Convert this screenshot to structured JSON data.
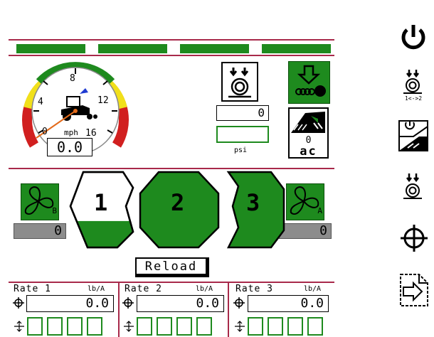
{
  "speedometer": {
    "labels": [
      "0",
      "4",
      "8",
      "12",
      "16"
    ],
    "unit": "mph",
    "speed": "0.0",
    "needle_value": 0
  },
  "seed_meter": {
    "value": "0",
    "unit": "psi"
  },
  "ac": {
    "count": "0",
    "label": "ac"
  },
  "fans": [
    {
      "letter": "B",
      "value": "0"
    },
    {
      "letter": "A",
      "value": "0"
    }
  ],
  "bins": [
    {
      "label": "1",
      "fill_fraction": 0.35
    },
    {
      "label": "2",
      "fill_fraction": 1.0
    },
    {
      "label": "3",
      "fill_fraction": 1.0
    }
  ],
  "reload_button": "Reload",
  "rates": [
    {
      "label": "Rate 1",
      "unit": "lb/A",
      "value": "0.0"
    },
    {
      "label": "Rate 2",
      "unit": "lb/A",
      "value": "0.0"
    },
    {
      "label": "Rate 3",
      "unit": "lb/A",
      "value": "0.0"
    }
  ],
  "sidebar": {
    "swap_label": "1<->2"
  },
  "colors": {
    "green": "#1e8a1e",
    "accent_line": "#a8294a",
    "grey": "#8c8c8c"
  }
}
